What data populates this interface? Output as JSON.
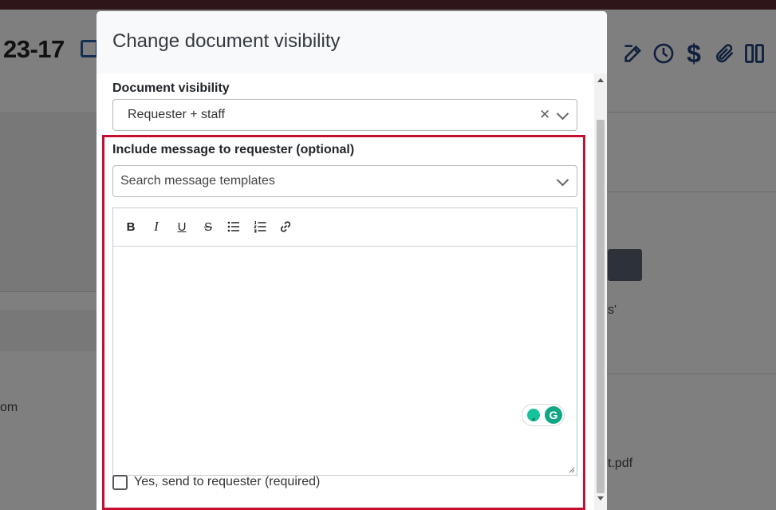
{
  "background": {
    "page_title_fragment": "23-17",
    "text_fragments": {
      "left_email_tail": "om",
      "right_quote_tail": "s'",
      "right_file_tail": "t.pdf"
    }
  },
  "modal": {
    "title": "Change document visibility",
    "visibility": {
      "label": "Document visibility",
      "selected_value": "Requester + staff"
    },
    "message": {
      "label": "Include message to requester (optional)",
      "template_search_placeholder": "Search message templates",
      "editor_value": ""
    },
    "toolbar": {
      "bold": "B",
      "italic": "I",
      "underline": "U",
      "strikethrough": "S"
    },
    "send_checkbox": {
      "label": "Yes, send to requester (required)",
      "checked": false
    },
    "grammarly_badge": "G"
  },
  "colors": {
    "highlight_border": "#c3102f",
    "icon_navy": "#1e3f7a",
    "grammarly_green": "#15c39a"
  }
}
